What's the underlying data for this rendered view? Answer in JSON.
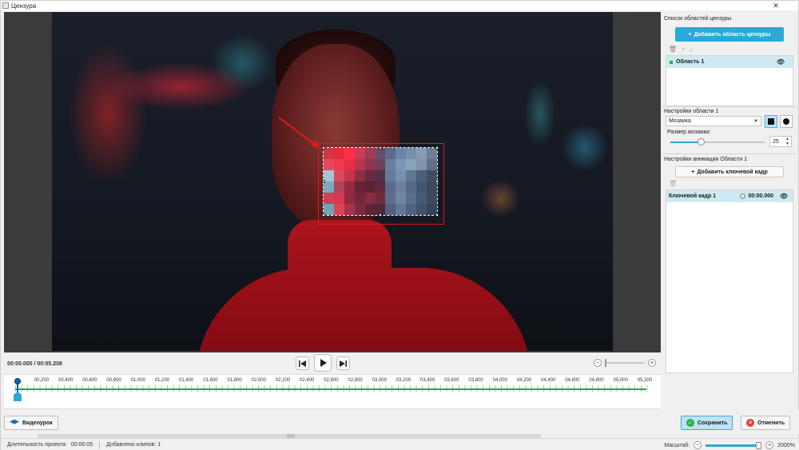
{
  "window": {
    "title": "Цензура",
    "close_glyph": "✕"
  },
  "preview": {
    "mosaic_colors": [
      [
        "#d13546",
        "#e62a3d",
        "#ff2f48",
        "#c73d58",
        "#9e3a5a",
        "#6b4a6f",
        "#5a6b8a",
        "#6b86a6",
        "#7a8fa8",
        "#8a9bb3",
        "#6e7f96"
      ],
      [
        "#e6475a",
        "#f03a4f",
        "#e82e45",
        "#b8354d",
        "#8d3552",
        "#6f3f5e",
        "#6a7fa0",
        "#7c97b6",
        "#8aa3bd",
        "#7e94ad",
        "#5f6f87"
      ],
      [
        "#a8c4d3",
        "#d84a5e",
        "#c6344a",
        "#8e2d44",
        "#6a2a40",
        "#52324b",
        "#637c9a",
        "#7790ad",
        "#5f7590",
        "#4d5f77",
        "#3f4e63"
      ],
      [
        "#7aa9c0",
        "#b14258",
        "#902c43",
        "#6a2237",
        "#5a2233",
        "#5e2b3c",
        "#566c8a",
        "#6a82a0",
        "#55698a",
        "#435670",
        "#3a4a5e"
      ],
      [
        "#cf3f55",
        "#d53a50",
        "#8f2a40",
        "#75263a",
        "#8c2c41",
        "#6e2a3d",
        "#5b6f8d",
        "#6f87a5",
        "#596e8c",
        "#465a73",
        "#3b4b60"
      ],
      [
        "#6fa3ba",
        "#e04256",
        "#a83247",
        "#7e2a3d",
        "#5e2536",
        "#52283a",
        "#4f6380",
        "#63799a",
        "#4f6384",
        "#41536c",
        "#35455a"
      ]
    ]
  },
  "transport": {
    "time": "00:00.000 / 00:05.208",
    "prev_icon": "skip-back-icon",
    "play_icon": "play-icon",
    "next_icon": "skip-forward-icon"
  },
  "timeline": {
    "labels": [
      "00,200",
      "00,400",
      "00,600",
      "00,800",
      "01,000",
      "01,200",
      "01,400",
      "01,600",
      "01,800",
      "02,000",
      "02,200",
      "02,400",
      "02,600",
      "02,800",
      "03,000",
      "03,200",
      "03,400",
      "03,600",
      "03,800",
      "04,000",
      "04,200",
      "04,400",
      "04,600",
      "04,800",
      "05,000",
      "05,200"
    ]
  },
  "panel": {
    "areas_title": "Список областей цензуры",
    "add_area_label": "Добавить область цензуры",
    "area_item": "Область 1",
    "area_settings_title": "Настройки области 1",
    "effect_select": "Мозаика",
    "mosaic_size_label": "Размер мозаики:",
    "mosaic_size_value": "25",
    "mosaic_size_fraction": 0.32,
    "animation_title": "Настройки анимации Области 1",
    "add_keyframe_label": "Добавить ключевой кадр",
    "keyframe_item": "Ключевой кадр 1",
    "keyframe_time": "00:00.000"
  },
  "bottom": {
    "tutorial_label": "Видеоурок",
    "save_label": "Сохранить",
    "cancel_label": "Отменить"
  },
  "status": {
    "duration_label": "Длительность проекта:",
    "duration_value": "00:00:05",
    "clips_added": "Добавлено клипов: 1",
    "scale_label": "Масштаб:",
    "scale_value": "2000%",
    "scale_fraction": 0.95
  },
  "colors": {
    "accent": "#2aa9d8",
    "frame": "#e21b1b",
    "track": "#27a843"
  }
}
